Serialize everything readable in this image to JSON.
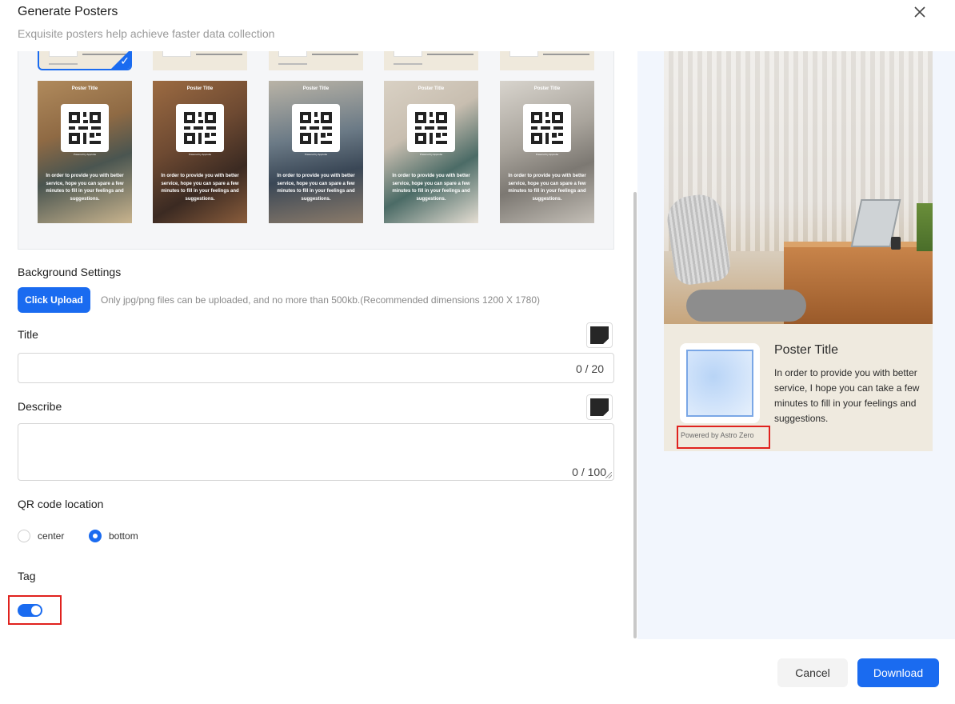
{
  "header": {
    "title": "Generate Posters",
    "subtitle": "Exquisite posters help achieve faster data collection"
  },
  "templates": {
    "top_row_count": 5,
    "selected_index": 0,
    "thumb_poster_title": "Poster Title",
    "thumb_powered_by": "Powered by Appcube",
    "thumb_desc": "In order to provide you with better service, hope you can spare a few minutes to fill in your feelings and suggestions."
  },
  "background": {
    "label": "Background Settings",
    "upload_label": "Click Upload",
    "hint": "Only jpg/png files can be uploaded, and no more than 500kb.(Recommended dimensions 1200 X 1780)"
  },
  "title_field": {
    "label": "Title",
    "value": "",
    "counter": "0 / 20"
  },
  "describe_field": {
    "label": "Describe",
    "value": "",
    "counter": "0 / 100"
  },
  "qr_location": {
    "label": "QR code location",
    "options": [
      "center",
      "bottom"
    ],
    "selected": "bottom"
  },
  "tag": {
    "label": "Tag",
    "enabled": true
  },
  "preview": {
    "poster_title": "Poster Title",
    "poster_desc": "In order to provide you with better service, I hope you can take a few minutes to fill in your feelings and suggestions.",
    "powered_by": "Powered by Astro Zero"
  },
  "footer": {
    "cancel_label": "Cancel",
    "download_label": "Download"
  },
  "colors": {
    "accent": "#1a6bf0",
    "highlight": "#e0221e",
    "preview_bg": "#f2f6fd",
    "poster_panel": "#efeadf"
  }
}
